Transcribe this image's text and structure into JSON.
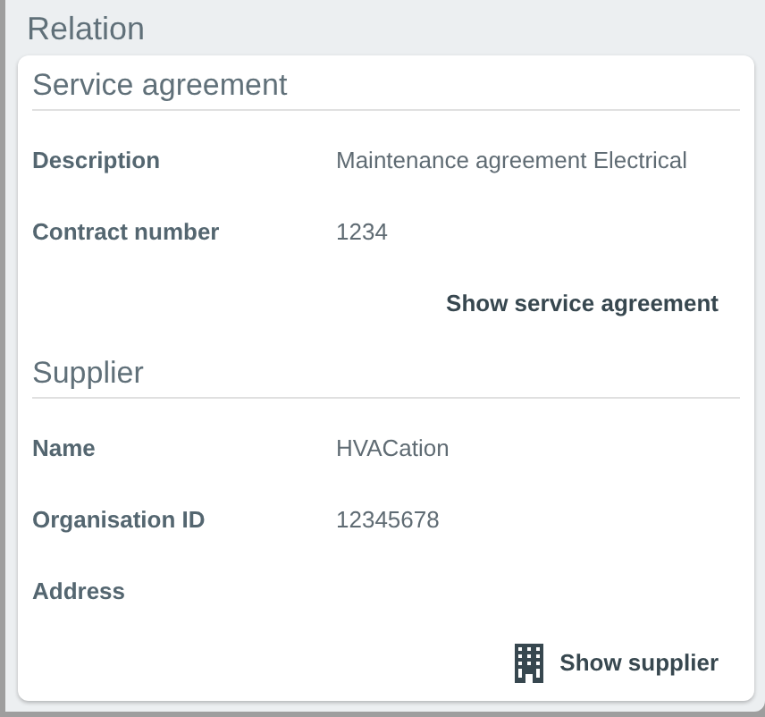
{
  "title": "Relation",
  "sections": [
    {
      "heading": "Service agreement",
      "fields": [
        {
          "label": "Description",
          "value": "Maintenance agreement Electrical"
        },
        {
          "label": "Contract number",
          "value": "1234"
        }
      ],
      "action": {
        "label": "Show service agreement",
        "kind": "text"
      }
    },
    {
      "heading": "Supplier",
      "fields": [
        {
          "label": "Name",
          "value": "HVACation"
        },
        {
          "label": "Organisation ID",
          "value": "12345678"
        },
        {
          "label": "Address"
        }
      ],
      "action": {
        "label": "Show supplier",
        "kind": "building"
      }
    }
  ]
}
